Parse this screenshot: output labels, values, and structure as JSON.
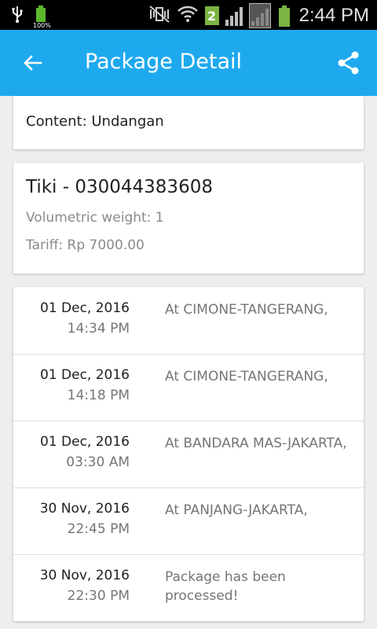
{
  "status_bar": {
    "battery_percent": "100%",
    "sim_badge": "2",
    "time": "2:44 PM"
  },
  "app_bar": {
    "title": "Package Detail",
    "color": "#1ea9ef"
  },
  "content_card": {
    "content": "Content: Undangan"
  },
  "package_card": {
    "tracking": "Tiki - 030044383608",
    "volumetric_weight": "Volumetric weight: 1",
    "tariff": "Tariff: Rp 7000.00"
  },
  "history": [
    {
      "date": "01 Dec, 2016",
      "time": "14:34 PM",
      "status": "At CIMONE-TANGERANG,"
    },
    {
      "date": "01 Dec, 2016",
      "time": "14:18 PM",
      "status": "At CIMONE-TANGERANG,"
    },
    {
      "date": "01 Dec, 2016",
      "time": "03:30 AM",
      "status": "At BANDARA MAS-JAKARTA,"
    },
    {
      "date": "30 Nov, 2016",
      "time": "22:45 PM",
      "status": "At PANJANG-JAKARTA,"
    },
    {
      "date": "30 Nov, 2016",
      "time": "22:30 PM",
      "status": "Package has been processed!"
    }
  ]
}
